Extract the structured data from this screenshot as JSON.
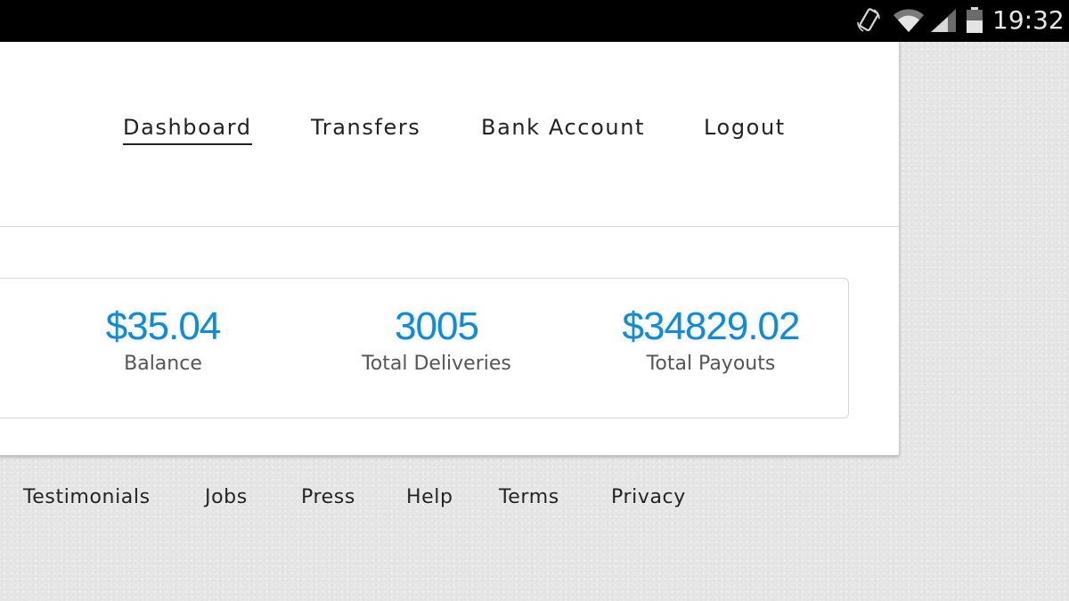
{
  "status_bar": {
    "time": "19:32",
    "icons": [
      "rotate-icon",
      "wifi-icon",
      "signal-icon",
      "battery-icon"
    ]
  },
  "nav": {
    "items": [
      {
        "label": "Dashboard",
        "active": true
      },
      {
        "label": "Transfers",
        "active": false
      },
      {
        "label": "Bank Account",
        "active": false
      },
      {
        "label": "Logout",
        "active": false
      }
    ]
  },
  "stats": [
    {
      "value": "$35.04",
      "label": "Balance"
    },
    {
      "value": "3005",
      "label": "Total Deliveries"
    },
    {
      "value": "$34829.02",
      "label": "Total Payouts"
    }
  ],
  "footer": {
    "links": [
      "Testimonials",
      "Jobs",
      "Press",
      "Help",
      "Terms",
      "Privacy"
    ]
  },
  "colors": {
    "accent": "#1789ce",
    "text": "#222222",
    "muted": "#555555",
    "status_bar": "#000000"
  }
}
